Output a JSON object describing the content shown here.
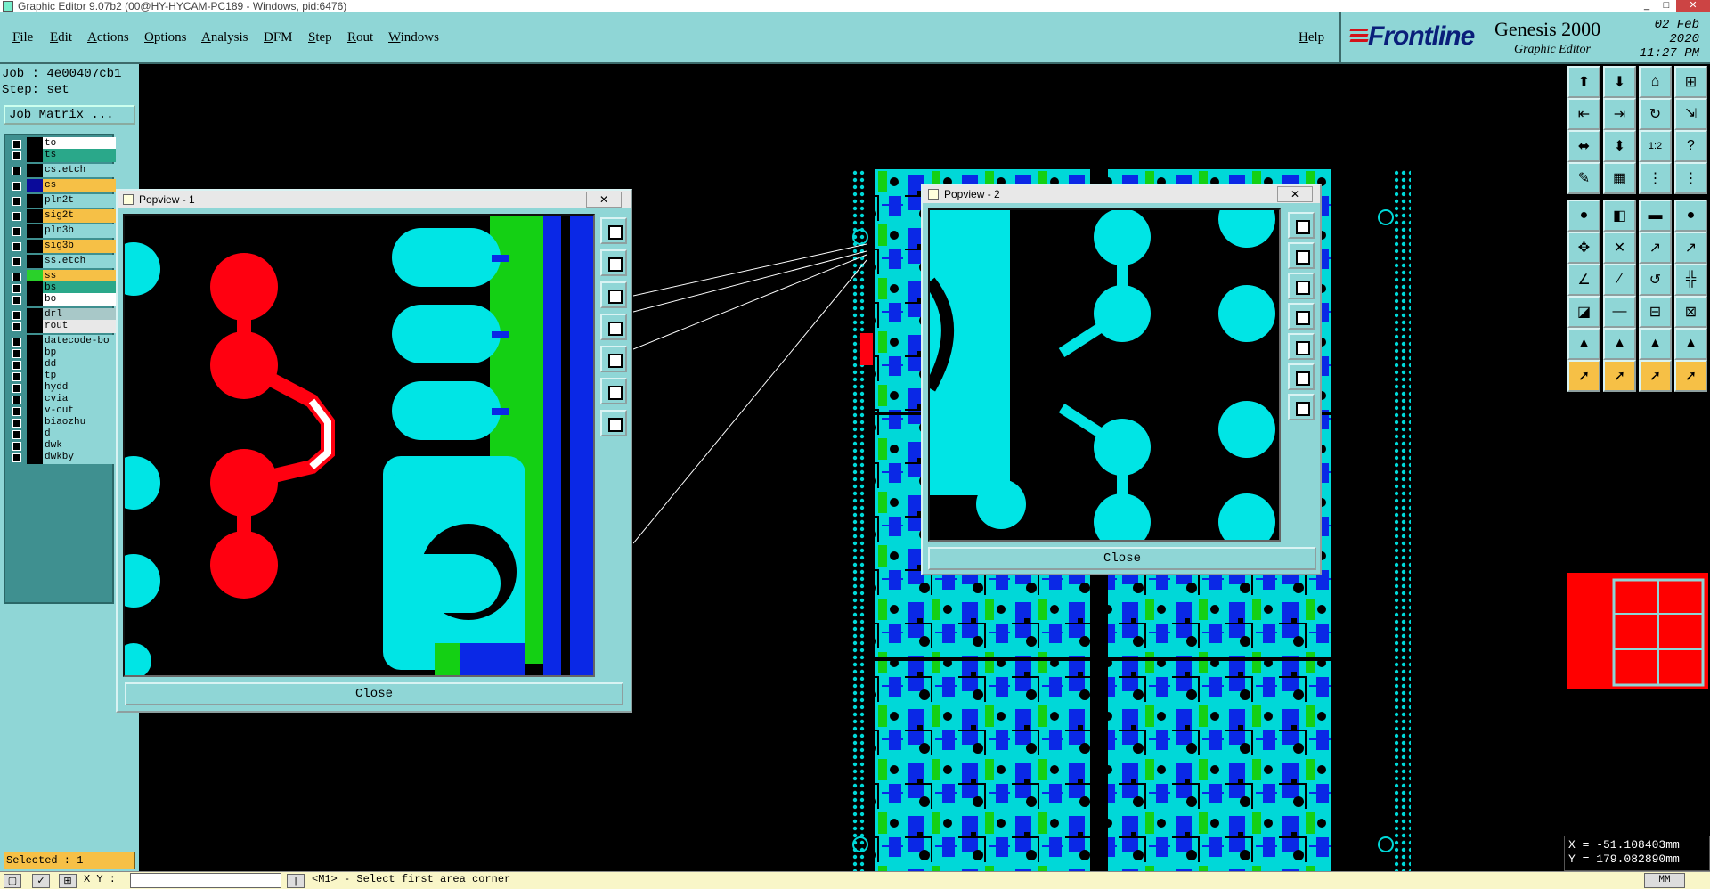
{
  "window": {
    "title": "Graphic Editor 9.07b2 (00@HY-HYCAM-PC189 - Windows, pid:6476)",
    "controls": [
      "_",
      "□",
      "✕"
    ]
  },
  "menu": {
    "items": [
      "File",
      "Edit",
      "Actions",
      "Options",
      "Analysis",
      "DFM",
      "Step",
      "Rout",
      "Windows"
    ],
    "help": "Help"
  },
  "brand": {
    "logo": "Frontline",
    "product": "Genesis 2000",
    "subtitle": "Graphic Editor",
    "date": "02 Feb 2020",
    "time": "11:27 PM"
  },
  "job": {
    "job_label": "Job : 4e00407cb1",
    "step_label": "Step: set",
    "matrix_button": "Job Matrix ..."
  },
  "layers": [
    {
      "name": "to",
      "color": "#ffffff",
      "swatch": "#000000"
    },
    {
      "name": "ts",
      "color": "#2aa88a",
      "swatch": "#000000"
    },
    {
      "name": "cs.etch",
      "color": "#8fd6d6",
      "swatch": "#000000"
    },
    {
      "name": "cs",
      "color": "#f6c046",
      "swatch": "#0a0a9a",
      "active": true
    },
    {
      "name": "pln2t",
      "color": "#8fd6d6",
      "swatch": "#000000"
    },
    {
      "name": "sig2t",
      "color": "#f6c046",
      "swatch": "#000000"
    },
    {
      "name": "pln3b",
      "color": "#8fd6d6",
      "swatch": "#000000"
    },
    {
      "name": "sig3b",
      "color": "#f6c046",
      "swatch": "#000000"
    },
    {
      "name": "ss.etch",
      "color": "#8fd6d6",
      "swatch": "#000000"
    },
    {
      "name": "ss",
      "color": "#f6c046",
      "swatch": "#2ad12a"
    },
    {
      "name": "bs",
      "color": "#2aa88a",
      "swatch": "#000000"
    },
    {
      "name": "bo",
      "color": "#ffffff",
      "swatch": "#000000"
    },
    {
      "name": "drl",
      "color": "#a8c8c8",
      "swatch": "#000000"
    },
    {
      "name": "rout",
      "color": "#e8e8e8",
      "swatch": "#000000"
    },
    {
      "name": "datecode-bo",
      "color": "#8fd6d6",
      "swatch": "#000000"
    },
    {
      "name": "bp",
      "color": "#8fd6d6",
      "swatch": "#000000"
    },
    {
      "name": "dd",
      "color": "#8fd6d6",
      "swatch": "#000000"
    },
    {
      "name": "tp",
      "color": "#8fd6d6",
      "swatch": "#000000"
    },
    {
      "name": "hydd",
      "color": "#8fd6d6",
      "swatch": "#000000"
    },
    {
      "name": "cvia",
      "color": "#8fd6d6",
      "swatch": "#000000"
    },
    {
      "name": "v-cut",
      "color": "#8fd6d6",
      "swatch": "#000000"
    },
    {
      "name": "biaozhu",
      "color": "#8fd6d6",
      "swatch": "#000000"
    },
    {
      "name": "d",
      "color": "#8fd6d6",
      "swatch": "#000000"
    },
    {
      "name": "dwk",
      "color": "#8fd6d6",
      "swatch": "#000000"
    },
    {
      "name": "dwkby",
      "color": "#8fd6d6",
      "swatch": "#000000"
    }
  ],
  "status": {
    "selected": "Selected : 1",
    "xy_label": "X Y :",
    "prompt": "<M1> - Select first area corner",
    "units": "MM"
  },
  "coords": {
    "x": "X = -51.108403mm",
    "y": "Y = 179.082890mm"
  },
  "popview1": {
    "title": "Popview - 1",
    "close_button": "Close",
    "close_x": "✕"
  },
  "popview2": {
    "title": "Popview - 2",
    "close_button": "Close",
    "close_x": "✕"
  },
  "colors": {
    "ui_teal": "#8fd6d6",
    "cyan": "#00e5e5",
    "green": "#14d014",
    "blue": "#0a28e6",
    "red": "#ff0010",
    "highlight": "#f6c046"
  }
}
